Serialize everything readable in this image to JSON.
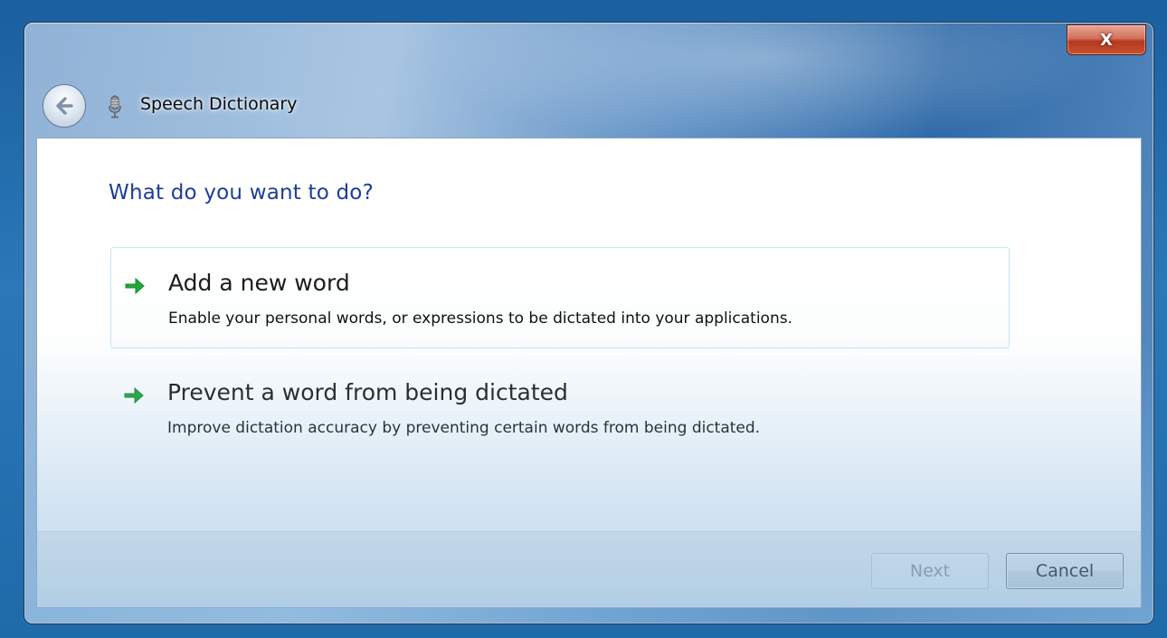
{
  "window": {
    "title": "Speech Dictionary",
    "close_label": "X",
    "icons": {
      "back": "back-arrow-icon",
      "app": "microphone-icon",
      "option_arrow": "green-arrow-icon"
    }
  },
  "main": {
    "heading": "What do you want to do?",
    "options": [
      {
        "title": "Add a new word",
        "description": "Enable your personal words, or expressions to be dictated into your applications.",
        "highlighted": true
      },
      {
        "title": "Prevent a word from being dictated",
        "description": "Improve dictation accuracy by preventing certain words from being dictated.",
        "highlighted": false
      }
    ]
  },
  "footer": {
    "next_label": "Next",
    "next_enabled": false,
    "cancel_label": "Cancel"
  },
  "colors": {
    "heading": "#1e3d99",
    "arrow": "#21a63a",
    "close_button": "#c7512f"
  }
}
